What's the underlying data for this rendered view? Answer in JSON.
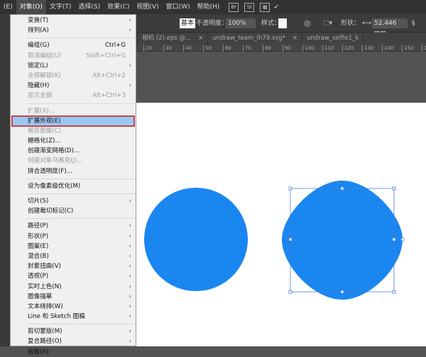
{
  "menubar": {
    "items": [
      "(E)",
      "对象(O)",
      "文字(T)",
      "选择(S)",
      "效果(C)",
      "视图(V)",
      "窗口(W)",
      "帮助(H)"
    ],
    "icons": [
      "Br",
      "St",
      "▦"
    ]
  },
  "control": {
    "stroke_label": "基本",
    "opacity_label": "不透明度：",
    "opacity_value": "100%",
    "style_label": "样式：",
    "shape_label": "形状：",
    "width_value": "52.446 mm"
  },
  "tabs": [
    "设",
    "eps @ 10...",
    "相机 (1).eps* ...",
    "相机 (2).eps @...",
    "undraw_team_ih79.svg*",
    "undraw_selfie1_k"
  ],
  "ruler": [
    "20",
    "30",
    "40",
    "50",
    "60",
    "70",
    "80",
    "90",
    "100",
    "110",
    "120",
    "130",
    "140",
    "150",
    "160"
  ],
  "menu": [
    {
      "label": "变换(T)",
      "sub": true
    },
    {
      "label": "排列(A)",
      "sub": true
    },
    {
      "sep": true
    },
    {
      "label": "编组(G)",
      "shortcut": "Ctrl+G"
    },
    {
      "label": "取消编组(U)",
      "shortcut": "Shift+Ctrl+G",
      "disabled": true
    },
    {
      "label": "锁定(L)",
      "sub": true
    },
    {
      "label": "全部解锁(K)",
      "shortcut": "Alt+Ctrl+2",
      "disabled": true
    },
    {
      "label": "隐藏(H)",
      "sub": true
    },
    {
      "label": "显示全部",
      "shortcut": "Alt+Ctrl+3",
      "disabled": true
    },
    {
      "sep": true
    },
    {
      "label": "扩展(X)...",
      "disabled": true
    },
    {
      "label": "扩展外观(E)",
      "highlight": true
    },
    {
      "label": "裁剪图像(C)",
      "disabled": true
    },
    {
      "label": "栅格化(Z)..."
    },
    {
      "label": "创建渐变网格(D)..."
    },
    {
      "label": "创建对象马赛克(J)...",
      "disabled": true
    },
    {
      "label": "拼合透明度(F)..."
    },
    {
      "sep": true
    },
    {
      "label": "设为像素级优化(M)"
    },
    {
      "sep": true
    },
    {
      "label": "切片(S)",
      "sub": true
    },
    {
      "label": "创建裁切标记(C)"
    },
    {
      "sep": true
    },
    {
      "label": "路径(P)",
      "sub": true
    },
    {
      "label": "形状(P)",
      "sub": true
    },
    {
      "label": "图案(E)",
      "sub": true
    },
    {
      "label": "混合(B)",
      "sub": true
    },
    {
      "label": "封套扭曲(V)",
      "sub": true
    },
    {
      "label": "透视(P)",
      "sub": true
    },
    {
      "label": "实时上色(N)",
      "sub": true
    },
    {
      "label": "图像描摹",
      "sub": true
    },
    {
      "label": "文本绕排(W)",
      "sub": true
    },
    {
      "label": "Line 和 Sketch 图稿",
      "sub": true
    },
    {
      "sep": true
    },
    {
      "label": "剪切蒙版(M)",
      "sub": true
    },
    {
      "label": "复合路径(O)",
      "sub": true
    },
    {
      "label": "画板(A)",
      "sub": true
    }
  ],
  "colors": {
    "shape_fill": "#1a86f0",
    "selection": "#4a7fd8",
    "highlight": "#99c9f5",
    "highlight_border": "#d0404a"
  }
}
